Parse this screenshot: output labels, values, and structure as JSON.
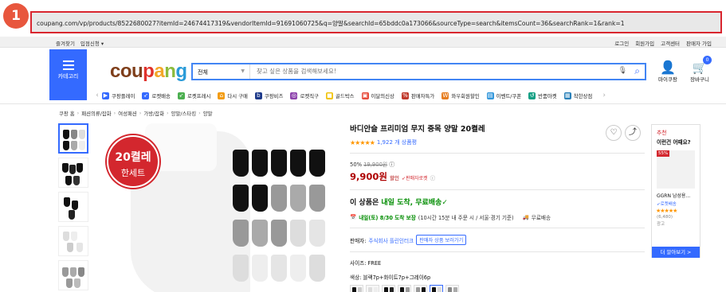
{
  "annotation_badge": "1",
  "url": "coupang.com/vp/products/8522680027?itemId=24674417319&vendorItemId=91691060725&q=양말&searchId=65bddc0a173066&sourceType=search&itemsCount=36&searchRank=1&rank=1",
  "utility": {
    "left": [
      "즐겨찾기",
      "입점신청 ▾"
    ],
    "right": [
      "로그인",
      "회원가입",
      "고객센터",
      "판매자 가입"
    ]
  },
  "header": {
    "category_label": "카테고리",
    "logo": {
      "c1": "cou",
      "c2": "p",
      "c3": "a",
      "c4": "n",
      "c5": "g"
    },
    "search_category": "전체",
    "search_placeholder": "찾고 싶은 상품을 검색해보세요!",
    "mycoupang_label": "마이쿠팡",
    "cart_label": "장바구니",
    "cart_count": "0"
  },
  "services": [
    {
      "label": "쿠팡플레이",
      "color": "#346aff"
    },
    {
      "label": "로켓배송",
      "color": "#346aff"
    },
    {
      "label": "로켓프레시",
      "color": "#4caf50"
    },
    {
      "label": "다시 구매",
      "color": "#f39c12"
    },
    {
      "label": "쿠팡비즈",
      "color": "#1e3a8a"
    },
    {
      "label": "로켓직구",
      "color": "#8e44ad"
    },
    {
      "label": "골드박스",
      "color": "#f1c40f"
    },
    {
      "label": "이달의신상",
      "color": "#e74c3c"
    },
    {
      "label": "판매자특가",
      "color": "#c0392b"
    },
    {
      "label": "와우회원할인",
      "color": "#e67e22"
    },
    {
      "label": "이벤트/쿠폰",
      "color": "#3498db"
    },
    {
      "label": "반품마켓",
      "color": "#16a085"
    },
    {
      "label": "착한상점",
      "color": "#2980b9"
    }
  ],
  "breadcrumb": [
    "쿠팡 홈",
    "패션의류/잡화",
    "여성패션",
    "가방/잡화",
    "양말/스타킹",
    "양말"
  ],
  "main_image": {
    "badge_line1": "20켤레",
    "badge_line2": "한세트"
  },
  "product": {
    "title": "바디안슬 프리미엄 무지 중목 양말 20켤레",
    "stars": "★★★★★",
    "review_count": "1,922 개 상품평",
    "discount_rate": "50%",
    "original_price": "19,900원",
    "info_icon": "ⓘ",
    "price": "9,900원",
    "sale_label": "할인",
    "rocket_label": "판매자로켓",
    "delivery_prefix": "이 상품은 ",
    "delivery_highlight": "내일 도착, 무료배송",
    "delivery_check": "✓",
    "arrival_highlight": "내일(토) 8/30 도착 보장",
    "arrival_rest": "(10시간 15분 내 주문 시 / 서울⋅경기 기준)",
    "free_shipping": "무료배송",
    "seller_label": "판매자:",
    "seller_name": "주식회사 플린인터크",
    "seller_button": "판매자 상품 보러가기",
    "size_label": "사이즈: FREE",
    "color_label": "색상: 블랙7p+화이트7p+그레이6p"
  },
  "recommend": {
    "title": "추천",
    "subtitle": "이런건 어때요?",
    "pct": "55%",
    "name": "GGRN 남성용...",
    "rocket": "로켓배송",
    "stars": "★★★★★",
    "count": "(6,480)",
    "ad": "광고",
    "more": "더 알아보기 >"
  }
}
